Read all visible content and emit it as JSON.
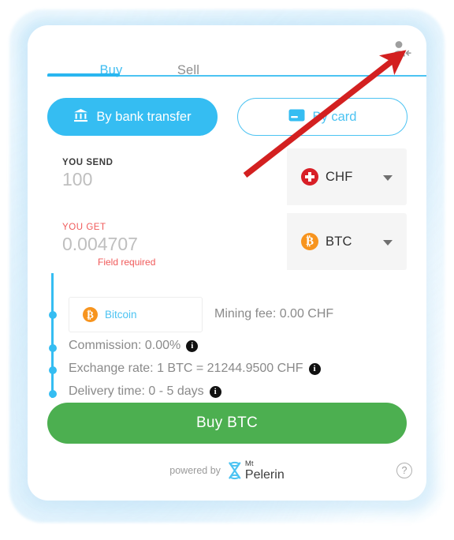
{
  "widget": {
    "account_icon": "person-add-icon",
    "tabs": [
      {
        "label": "Buy",
        "active": true
      },
      {
        "label": "Sell",
        "active": false
      }
    ],
    "payment_methods": [
      {
        "label": "By bank transfer",
        "icon": "bank-icon",
        "active": true
      },
      {
        "label": "By card",
        "icon": "credit-card-icon",
        "active": false
      }
    ],
    "send_field": {
      "label": "YOU SEND",
      "value": "100",
      "placeholder": "100",
      "currency": "CHF",
      "currency_icon": "swiss-flag-icon"
    },
    "get_field": {
      "label": "YOU GET",
      "value": "0.004707",
      "placeholder": "0.004707",
      "error": "Field required",
      "currency": "BTC",
      "currency_icon": "bitcoin-icon"
    },
    "details": {
      "network": {
        "label": "Bitcoin",
        "icon": "bitcoin-icon"
      },
      "mining_fee": "Mining fee: 0.00 CHF",
      "commission": "Commission: 0.00%",
      "exchange_rate": "Exchange rate: 1 BTC = 21244.9500 CHF",
      "delivery_time": "Delivery time: 0 - 5 days",
      "info_glyph": "i"
    },
    "cta_label": "Buy BTC",
    "footer": {
      "powered_by": "powered by",
      "brand_top": "Mt",
      "brand_bottom": "Pelerin",
      "help_glyph": "?"
    },
    "colors": {
      "brand_blue": "#35BDF2",
      "cta_green": "#4CAF50",
      "error_red": "#F05A5A",
      "bitcoin_orange": "#F7941E",
      "swiss_red": "#D81F27",
      "annotation_red": "#D32020"
    }
  }
}
